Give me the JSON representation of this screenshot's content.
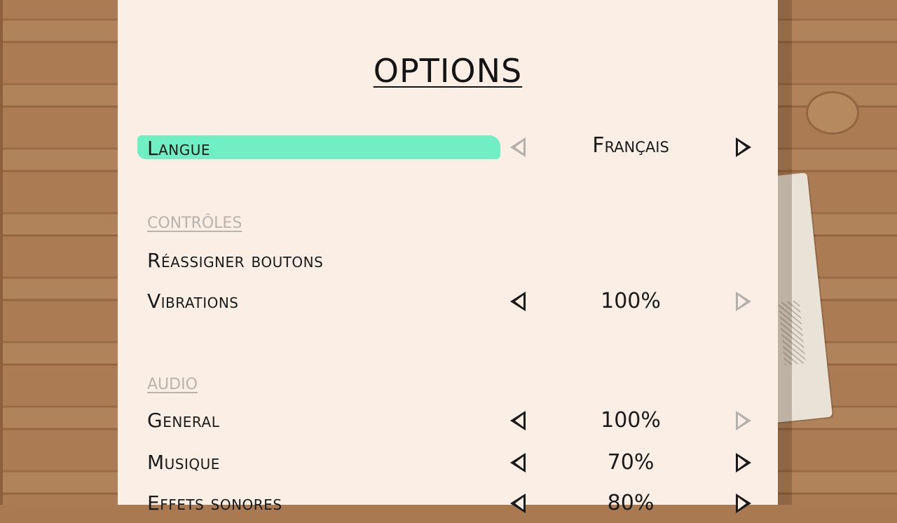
{
  "title": "OPTIONS",
  "language": {
    "label": "Langue",
    "value": "Français",
    "left_arrow_enabled": false,
    "right_arrow_enabled": true
  },
  "sections": {
    "controls": "CONTRÔLES",
    "audio": "AUDIO"
  },
  "controls": {
    "remap_label": "Réassigner boutons",
    "vibrations_label": "Vibrations",
    "vibrations_value": "100%"
  },
  "audio": {
    "general_label": "General",
    "general_value": "100%",
    "music_label": "Musique",
    "music_value": "70%",
    "sfx_label": "Effets sonores",
    "sfx_value": "80%"
  },
  "colors": {
    "paper": "#fbefe5",
    "highlight": "#70efc4",
    "text": "#1a1a1a",
    "disabled": "#b3b0ab"
  }
}
